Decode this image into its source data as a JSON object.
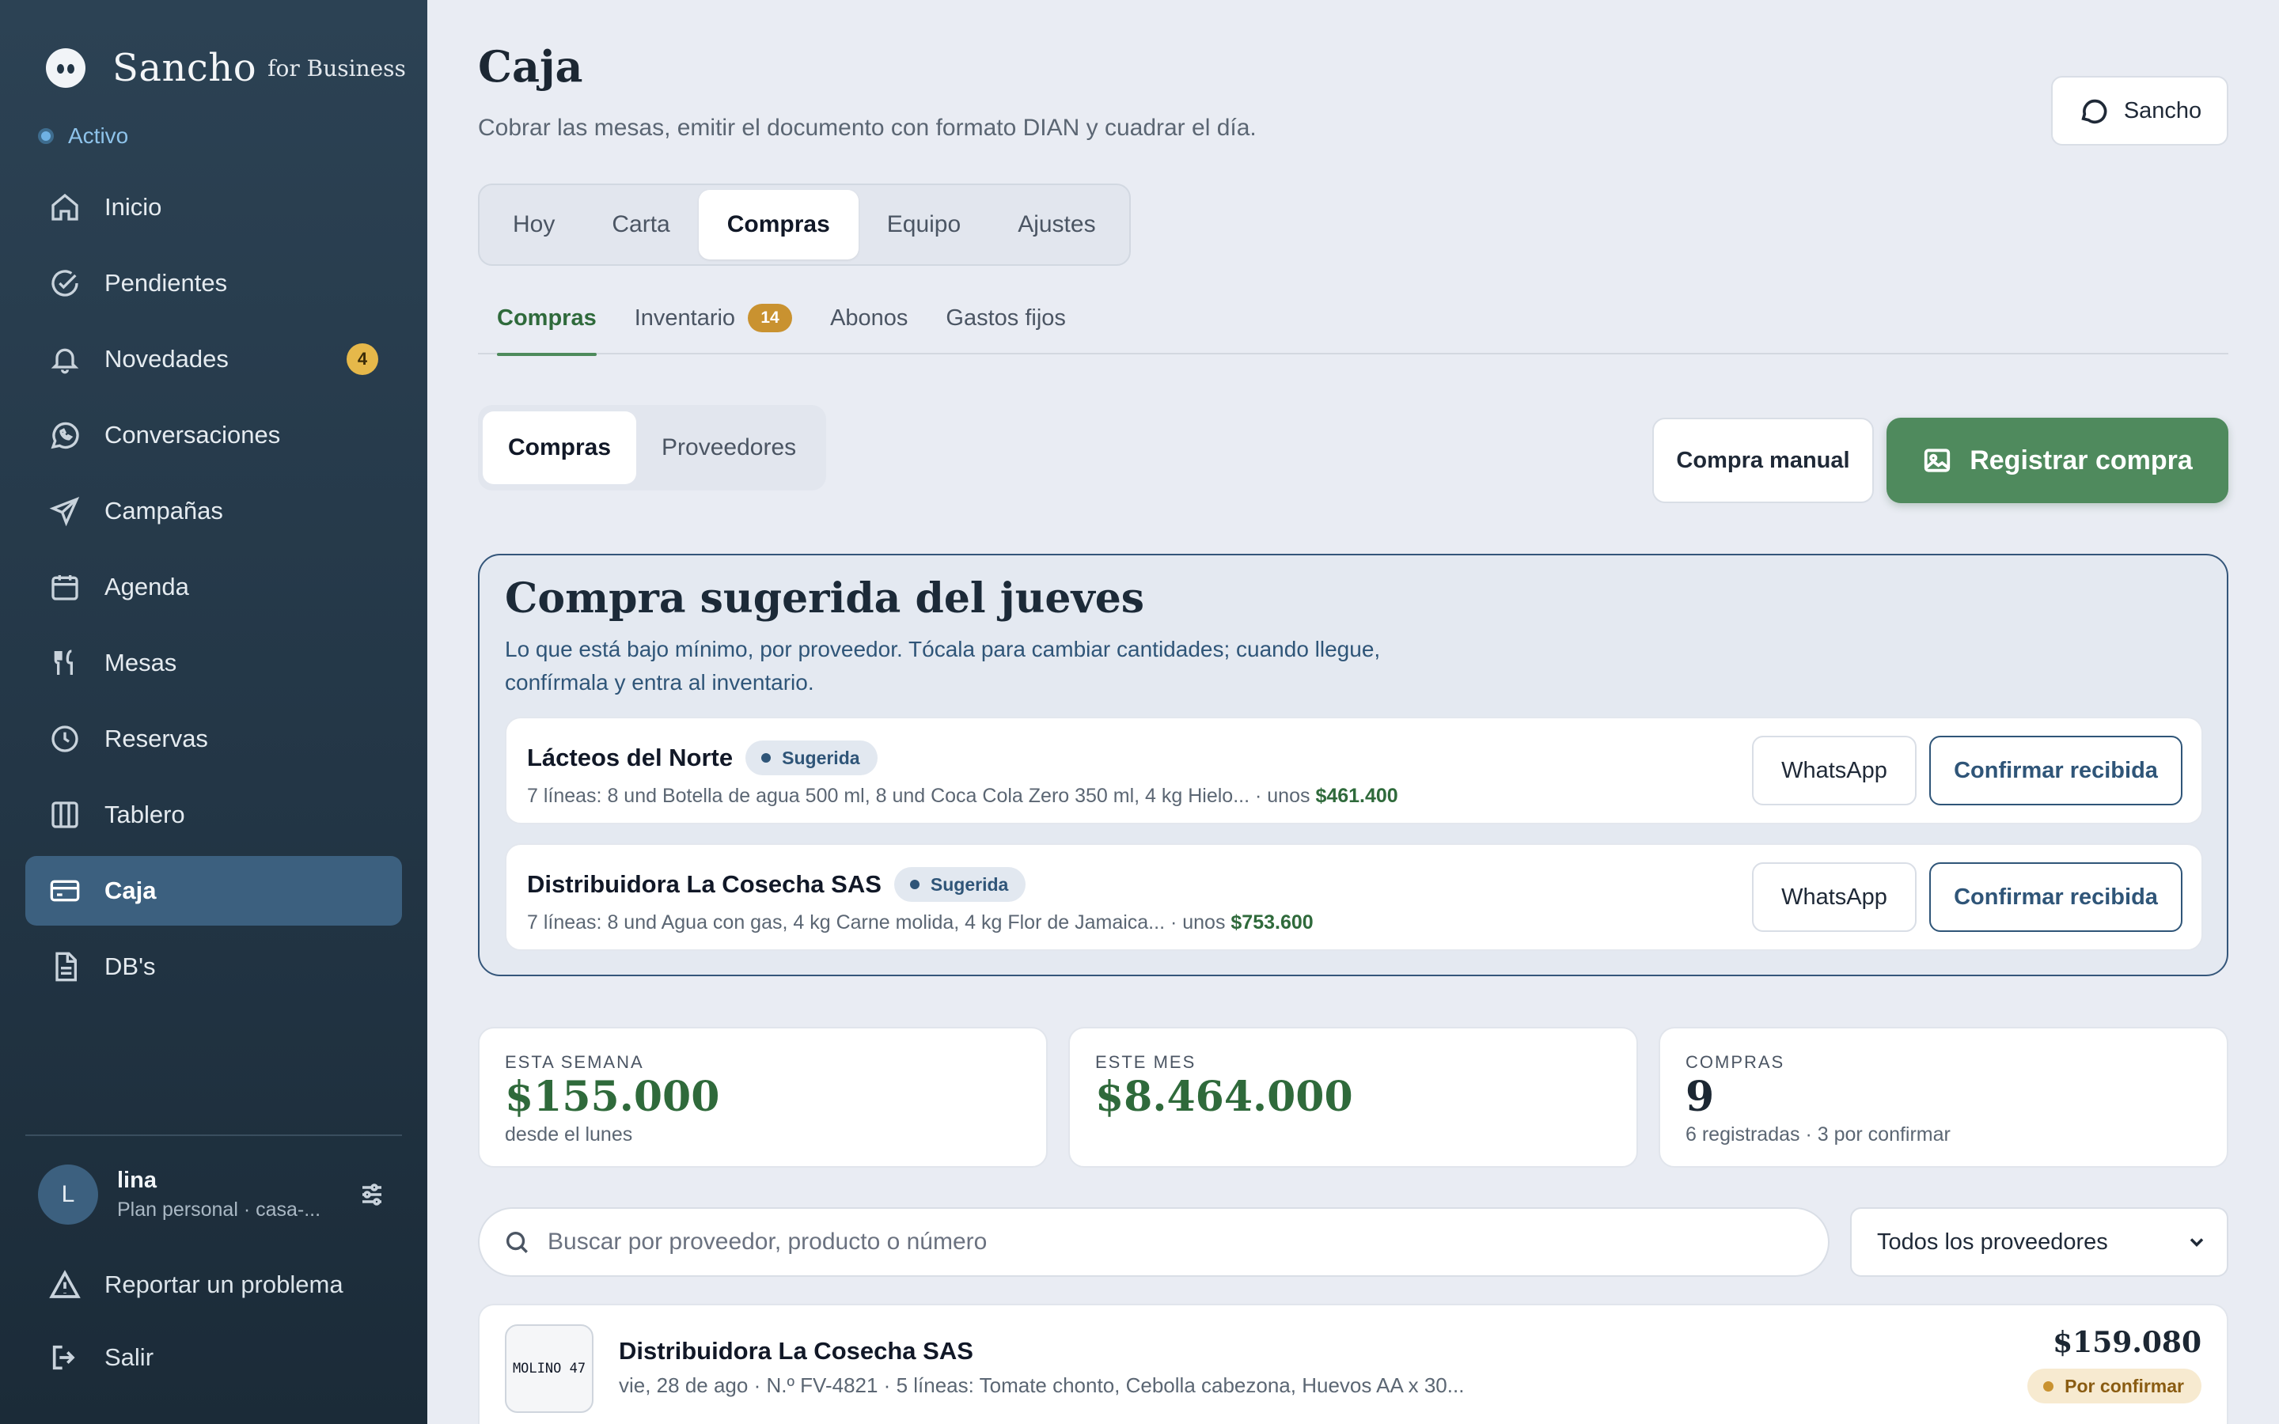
{
  "brand": {
    "name": "Sancho",
    "suffix": "for Business"
  },
  "status": {
    "label": "Activo"
  },
  "sidebar": {
    "items": [
      {
        "label": "Inicio",
        "icon": "home-icon"
      },
      {
        "label": "Pendientes",
        "icon": "check-circle-icon"
      },
      {
        "label": "Novedades",
        "icon": "bell-icon",
        "badge": "4"
      },
      {
        "label": "Conversaciones",
        "icon": "whatsapp-icon"
      },
      {
        "label": "Campañas",
        "icon": "send-icon"
      },
      {
        "label": "Agenda",
        "icon": "calendar-icon"
      },
      {
        "label": "Mesas",
        "icon": "utensils-icon"
      },
      {
        "label": "Reservas",
        "icon": "clock-icon"
      },
      {
        "label": "Tablero",
        "icon": "columns-icon"
      },
      {
        "label": "Caja",
        "icon": "credit-card-icon",
        "active": true
      },
      {
        "label": "DB's",
        "icon": "document-icon"
      }
    ],
    "user": {
      "initial": "L",
      "name": "lina",
      "plan": "Plan personal · casa-..."
    },
    "report": "Reportar un problema",
    "logout": "Salir"
  },
  "header": {
    "title": "Caja",
    "subtitle": "Cobrar las mesas, emitir el documento con formato DIAN y cuadrar el día.",
    "assistant_button": "Sancho"
  },
  "tabs": [
    "Hoy",
    "Carta",
    "Compras",
    "Equipo",
    "Ajustes"
  ],
  "active_tab": "Compras",
  "subtabs": [
    {
      "label": "Compras",
      "active": true
    },
    {
      "label": "Inventario",
      "badge": "14"
    },
    {
      "label": "Abonos"
    },
    {
      "label": "Gastos fijos"
    }
  ],
  "segment": {
    "items": [
      "Compras",
      "Proveedores"
    ],
    "active": "Compras"
  },
  "actions": {
    "manual": "Compra manual",
    "register": "Registrar compra"
  },
  "suggested": {
    "title": "Compra sugerida del jueves",
    "description": "Lo que está bajo mínimo, por proveedor. Tócala para cambiar cantidades; cuando llegue, confírmala y entra al inventario.",
    "cards": [
      {
        "supplier": "Lácteos del Norte",
        "status": "Sugerida",
        "lines": "7 líneas: 8 und Botella de agua 500 ml, 8 und Coca Cola Zero 350 ml, 4 kg Hielo... · unos ",
        "amount": "$461.400",
        "whatsapp": "WhatsApp",
        "confirm": "Confirmar recibida"
      },
      {
        "supplier": "Distribuidora La Cosecha SAS",
        "status": "Sugerida",
        "lines": "7 líneas: 8 und Agua con gas, 4 kg Carne molida, 4 kg Flor de Jamaica... · unos ",
        "amount": "$753.600",
        "whatsapp": "WhatsApp",
        "confirm": "Confirmar recibida"
      }
    ]
  },
  "stats": [
    {
      "label": "ESTA SEMANA",
      "value": "$155.000",
      "note": "desde el lunes"
    },
    {
      "label": "ESTE MES",
      "value": "$8.464.000",
      "note": ""
    },
    {
      "label": "COMPRAS",
      "value": "9",
      "note": "6 registradas · 3 por confirmar"
    }
  ],
  "search": {
    "placeholder": "Buscar por proveedor, producto o número"
  },
  "filter": {
    "selected": "Todos los proveedores"
  },
  "purchases": [
    {
      "logo_text": "MOLINO 47",
      "supplier": "Distribuidora La Cosecha SAS",
      "meta": "vie, 28 de ago · N.º FV-4821 · 5 líneas: Tomate chonto, Cebolla cabezona, Huevos AA x 30...",
      "amount": "$159.080",
      "status": "Por confirmar"
    }
  ],
  "colors": {
    "accent": "#4f8a5d",
    "sidebar": "#233646",
    "link": "#2f5578",
    "warning": "#c99230"
  }
}
